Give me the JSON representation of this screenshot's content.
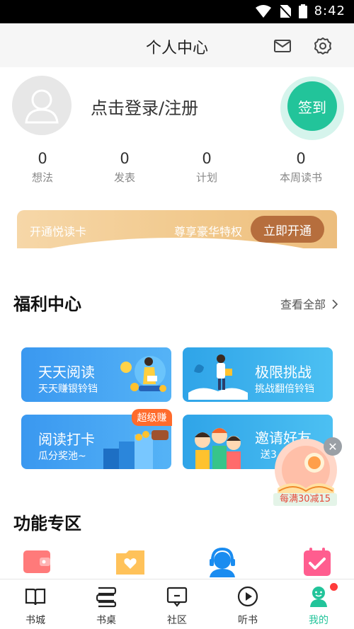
{
  "status_bar": {
    "time": "8:42"
  },
  "header": {
    "title": "个人中心"
  },
  "profile": {
    "login_text": "点击登录/注册",
    "checkin_label": "签到"
  },
  "stats": [
    {
      "value": "0",
      "label": "想法"
    },
    {
      "value": "0",
      "label": "发表"
    },
    {
      "value": "0",
      "label": "计划"
    },
    {
      "value": "0",
      "label": "本周读书"
    }
  ],
  "vip": {
    "label": "开通悦读卡",
    "privilege": "尊享豪华特权",
    "button": "立即开通"
  },
  "welfare": {
    "title": "福利中心",
    "see_all": "查看全部",
    "cards": [
      {
        "title": "天天阅读",
        "subtitle": "天天赚银铃铛"
      },
      {
        "title": "极限挑战",
        "subtitle": "挑战翻倍铃铛"
      },
      {
        "title": "阅读打卡",
        "subtitle": "瓜分奖池~",
        "badge": "超级赚"
      },
      {
        "title": "邀请好友",
        "subtitle": "送3"
      }
    ]
  },
  "promo": {
    "label": "每满30减15"
  },
  "functions": {
    "title": "功能专区",
    "icons": [
      "wallet-icon",
      "folder-heart-icon",
      "customer-service-icon",
      "calendar-check-icon"
    ]
  },
  "bottom_nav": [
    {
      "label": "书城",
      "icon": "book-icon"
    },
    {
      "label": "书桌",
      "icon": "bookshelf-icon"
    },
    {
      "label": "社区",
      "icon": "community-icon"
    },
    {
      "label": "听书",
      "icon": "play-icon"
    },
    {
      "label": "我的",
      "icon": "profile-icon",
      "active": true
    }
  ],
  "colors": {
    "accent": "#22c49a",
    "vip_button": "#b66e3d",
    "badge": "#ff6b2c",
    "card_blue": "#3a98f0"
  }
}
